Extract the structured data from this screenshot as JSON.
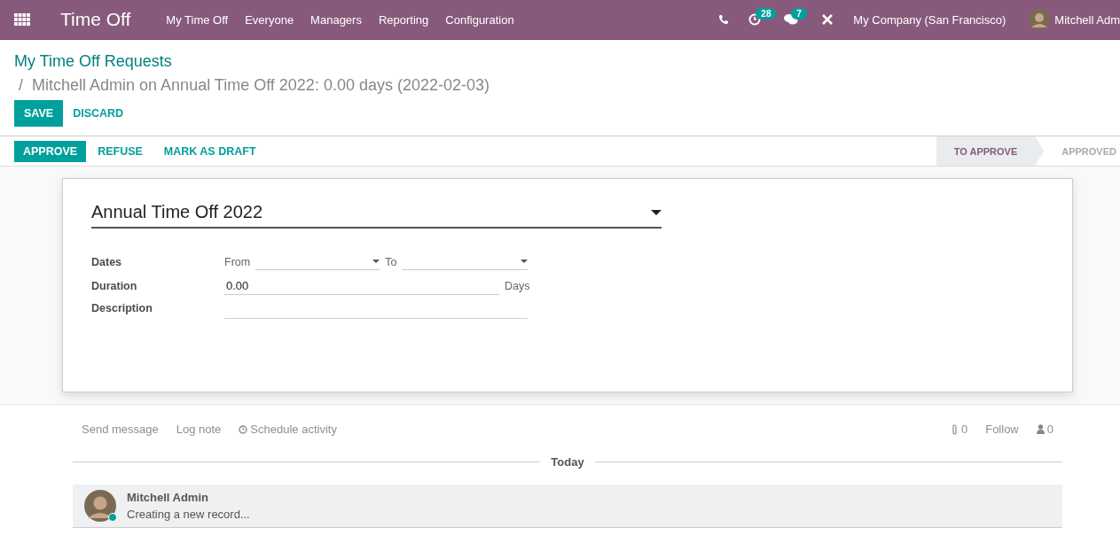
{
  "navbar": {
    "app_title": "Time Off",
    "menu": [
      "My Time Off",
      "Everyone",
      "Managers",
      "Reporting",
      "Configuration"
    ],
    "activity_count": "28",
    "message_count": "7",
    "company": "My Company (San Francisco)",
    "user_name": "Mitchell Adm"
  },
  "breadcrumb": {
    "parent": "My Time Off Requests",
    "separator": "/",
    "current": "Mitchell Admin on Annual Time Off 2022: 0.00 days (2022-02-03)"
  },
  "edit_buttons": [
    {
      "label": "SAVE",
      "kind": "primary"
    },
    {
      "label": "DISCARD",
      "kind": "link"
    }
  ],
  "status_actions": [
    {
      "label": "APPROVE",
      "kind": "primary"
    },
    {
      "label": "REFUSE",
      "kind": "link"
    },
    {
      "label": "MARK AS DRAFT",
      "kind": "link"
    }
  ],
  "stages": [
    {
      "label": "TO APPROVE",
      "selected": true
    },
    {
      "label": "APPROVED",
      "selected": false
    }
  ],
  "form": {
    "leave_type": "Annual Time Off 2022",
    "dates_label": "Dates",
    "from_label": "From",
    "to_label": "To",
    "duration_label": "Duration",
    "duration": "0.00",
    "duration_unit": "Days",
    "description_label": "Description"
  },
  "chatter": {
    "actions": [
      "Send message",
      "Log note",
      "Schedule activity"
    ],
    "attachments": "0",
    "follow": "Follow",
    "followers": "0",
    "date_separator": "Today",
    "messages": [
      {
        "author": "Mitchell Admin",
        "body": "Creating a new record...",
        "online": true
      }
    ]
  }
}
